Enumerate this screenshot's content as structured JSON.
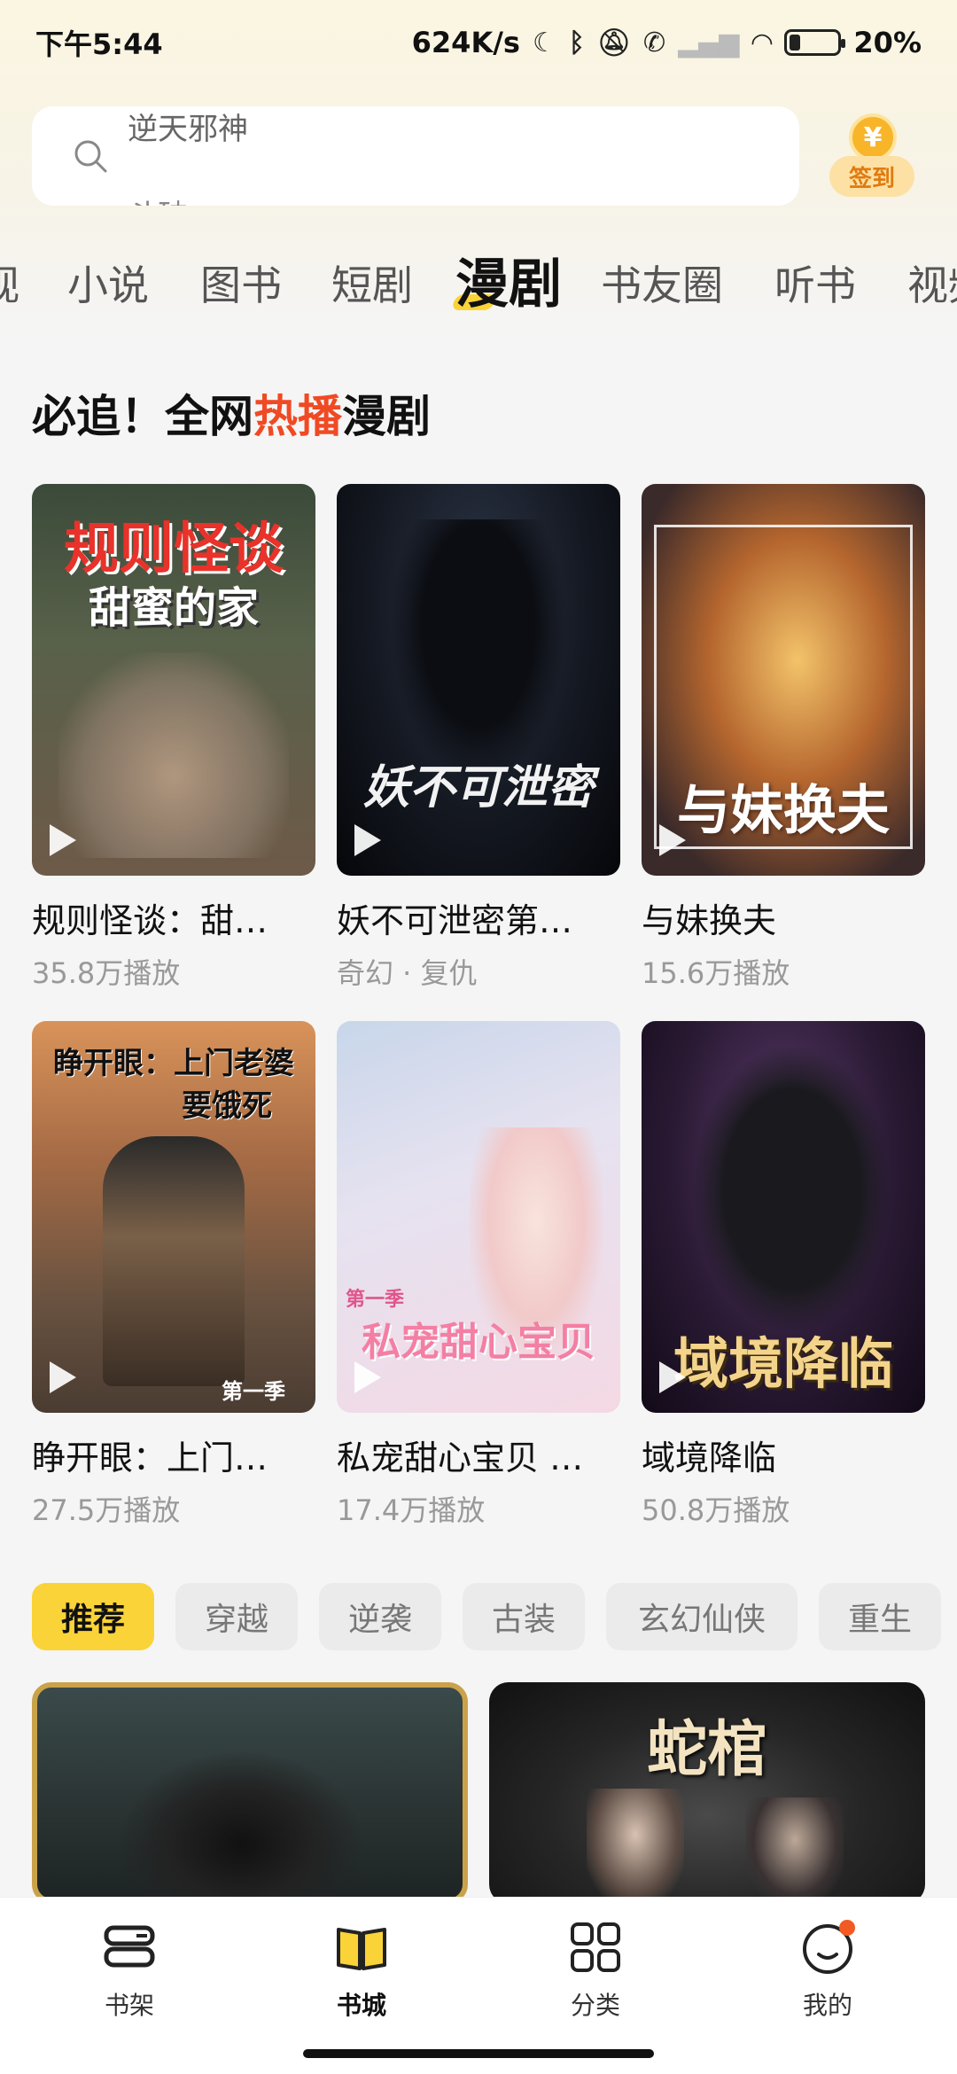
{
  "status_bar": {
    "time": "下午5:44",
    "network_speed": "624K/s",
    "battery": "20%"
  },
  "search": {
    "rotating_prev": "逆天邪神",
    "rotating_next": "斗破"
  },
  "signin": {
    "coin_symbol": "¥",
    "label": "签到"
  },
  "tabs": [
    "视",
    "小说",
    "图书",
    "短剧",
    "漫剧",
    "书友圈",
    "听书",
    "视频"
  ],
  "active_tab": "漫剧",
  "section": {
    "title_prefix": "必追！全网",
    "title_hot": "热播",
    "title_suffix": "漫剧"
  },
  "drama_cards": [
    {
      "title": "规则怪谈：甜…",
      "sub": "35.8万播放",
      "cover_text_1": "规则怪谈",
      "cover_text_2": "甜蜜的家",
      "icon": "play-icon"
    },
    {
      "title": "妖不可泄密第…",
      "sub": "奇幻 · 复仇",
      "cover_text_1": "妖不可泄密",
      "icon": "play-icon"
    },
    {
      "title": "与妹换夫",
      "sub": "15.6万播放",
      "cover_text_1": "与妹换夫",
      "icon": "play-icon"
    },
    {
      "title": "睁开眼：上门…",
      "sub": "27.5万播放",
      "cover_text_1": "睁开眼：上门老婆",
      "cover_text_2": "要饿死",
      "cover_text_3": "第一季",
      "icon": "play-icon"
    },
    {
      "title": "私宠甜心宝贝 …",
      "sub": "17.4万播放",
      "cover_text_1": "第一季",
      "cover_text_2": "私宠甜心宝贝",
      "icon": "play-icon"
    },
    {
      "title": "域境降临",
      "sub": "50.8万播放",
      "cover_text_1": "域境降临",
      "icon": "play-icon"
    }
  ],
  "chips": [
    "推荐",
    "穿越",
    "逆袭",
    "古装",
    "玄幻仙侠",
    "重生"
  ],
  "active_chip": "推荐",
  "big_cards": [
    {
      "cover_text": ""
    },
    {
      "cover_text": "蛇棺"
    }
  ],
  "bottom_nav": [
    {
      "label": "书架",
      "icon": "bookshelf-icon"
    },
    {
      "label": "书城",
      "icon": "book-open-icon"
    },
    {
      "label": "分类",
      "icon": "grid-icon"
    },
    {
      "label": "我的",
      "icon": "profile-icon"
    }
  ],
  "active_nav": "书城",
  "colors": {
    "accent": "#fad338",
    "hot": "#f04a24",
    "notification_dot": "#f25a24"
  }
}
